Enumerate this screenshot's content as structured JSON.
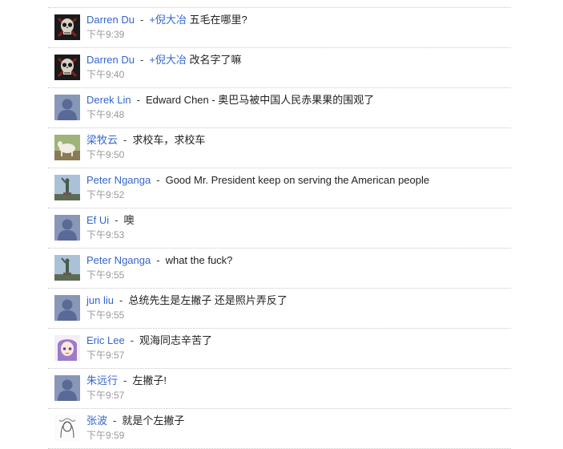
{
  "comments": [
    {
      "avatar": "skull",
      "author": "Darren Du",
      "mention": "倪大冶",
      "text": "五毛在哪里?",
      "time": "下午9:39"
    },
    {
      "avatar": "skull",
      "author": "Darren Du",
      "mention": "倪大冶",
      "text": "改名字了嘛",
      "time": "下午9:40"
    },
    {
      "avatar": "default",
      "author": "Derek Lin",
      "mention": "",
      "text": "Edward Chen - 奥巴马被中国人民赤果果的围观了",
      "time": "下午9:48"
    },
    {
      "avatar": "goat",
      "author": "梁牧云",
      "mention": "",
      "text": "求校车，求校车",
      "time": "下午9:50"
    },
    {
      "avatar": "statue",
      "author": "Peter Nganga",
      "mention": "",
      "text": "Good Mr. President keep on serving the American people",
      "time": "下午9:52"
    },
    {
      "avatar": "default",
      "author": "Ef Ui",
      "mention": "",
      "text": "噢",
      "time": "下午9:53"
    },
    {
      "avatar": "statue",
      "author": "Peter Nganga",
      "mention": "",
      "text": "what the fuck?",
      "time": "下午9:55"
    },
    {
      "avatar": "default",
      "author": "jun liu",
      "mention": "",
      "text": "总统先生是左撇子 还是照片弄反了",
      "time": "下午9:55"
    },
    {
      "avatar": "anime",
      "author": "Eric Lee",
      "mention": "",
      "text": "观海同志辛苦了",
      "time": "下午9:57"
    },
    {
      "avatar": "default",
      "author": "朱远行",
      "mention": "",
      "text": "左撇子!",
      "time": "下午9:57"
    },
    {
      "avatar": "sketch",
      "author": "张波",
      "mention": "",
      "text": "就是个左撇子",
      "time": "下午9:59"
    }
  ],
  "separator": "-",
  "mention_prefix": "+"
}
